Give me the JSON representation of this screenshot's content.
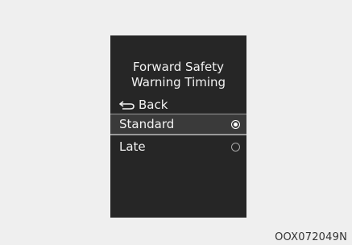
{
  "screen": {
    "title_line1": "Forward Safety",
    "title_line2": "Warning Timing",
    "back": {
      "label": "Back",
      "icon": "back-arrow-icon"
    },
    "options": [
      {
        "label": "Standard",
        "selected": true
      },
      {
        "label": "Late",
        "selected": false
      }
    ]
  },
  "figure_code": "OOX072049N"
}
